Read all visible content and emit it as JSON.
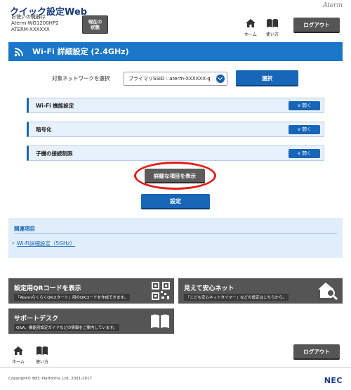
{
  "header": {
    "app_title": "クイック設定Web",
    "device_lines": [
      "お使いの機器は",
      "Aterm WG1200HP2",
      "ATERM-XXXXXX"
    ],
    "status_button": [
      "現在の",
      "状態"
    ],
    "brand": "Aterm",
    "home_label": "ホーム",
    "manual_label": "使い方",
    "logout_label": "ログアウト"
  },
  "page": {
    "title": "Wi-Fi 詳細設定 (2.4GHz)",
    "network_label": "対象ネットワークを選択",
    "network_value": "プライマリSSID : aterm-XXXXXX-g",
    "select_button": "選択",
    "accordions": [
      {
        "title": "Wi-Fi 機能設定",
        "button": "開く"
      },
      {
        "title": "暗号化",
        "button": "開く"
      },
      {
        "title": "子機の接続制限",
        "button": "開く"
      }
    ],
    "detail_button": "詳細な項目を表示",
    "set_button": "設定"
  },
  "related": {
    "heading": "関連項目",
    "link": "Wi-Fi詳細設定（5GHz）"
  },
  "tiles": {
    "qr": {
      "title": "設定用QRコードを表示",
      "desc": "「AtermらくらくQRスタート」用のQRコードを作成できます。"
    },
    "safe": {
      "title": "見えて安心ネット",
      "desc": "「こども安心ネットタイマー」などの設定はこちらから。"
    },
    "support": {
      "title": "サポートデスク",
      "desc": "Q&A、機能別設定ガイドなどの情報をご案内しています。"
    }
  },
  "footer": {
    "home_label": "ホーム",
    "manual_label": "使い方",
    "logout_label": "ログアウト",
    "copyright": "Copyright© NEC Platforms, Ltd. 2001-2017",
    "nec": "NEC"
  },
  "colors": {
    "accent_blue": "#1766b8",
    "title_blue": "#1976c8",
    "highlight_red": "#e41c1c",
    "dark_gray": "#555555"
  }
}
